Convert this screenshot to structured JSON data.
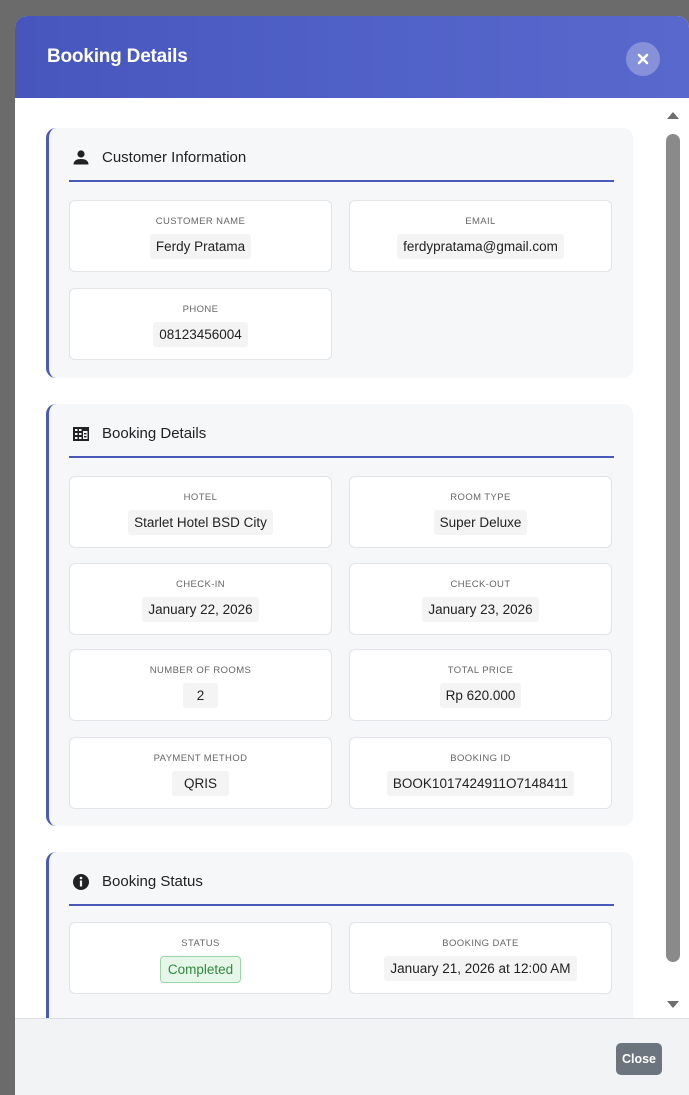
{
  "modal": {
    "title": "Booking Details",
    "close_button_label": "Close"
  },
  "customer_info": {
    "title": "Customer Information",
    "icon": "user-icon",
    "fields": [
      {
        "label": "CUSTOMER NAME",
        "value": "Ferdy Pratama"
      },
      {
        "label": "EMAIL",
        "value": "ferdypratama@gmail.com"
      },
      {
        "label": "PHONE",
        "value": "08123456004"
      }
    ]
  },
  "booking_details": {
    "title": "Booking Details",
    "icon": "building-icon",
    "fields": [
      {
        "label": "HOTEL",
        "value": "Starlet Hotel BSD City"
      },
      {
        "label": "ROOM TYPE",
        "value": "Super Deluxe"
      },
      {
        "label": "CHECK-IN",
        "value": "January 22, 2026"
      },
      {
        "label": "CHECK-OUT",
        "value": "January 23, 2026"
      },
      {
        "label": "NUMBER OF ROOMS",
        "value": "2"
      },
      {
        "label": "TOTAL PRICE",
        "value": "Rp 620.000"
      },
      {
        "label": "PAYMENT METHOD",
        "value": "QRIS"
      },
      {
        "label": "BOOKING ID",
        "value": "BOOK1017424911O7148411"
      }
    ]
  },
  "booking_status": {
    "title": "Booking Status",
    "icon": "info-icon",
    "fields": [
      {
        "label": "STATUS",
        "value": "Completed"
      },
      {
        "label": "BOOKING DATE",
        "value": "January 21, 2026 at 12:00 AM"
      }
    ]
  },
  "colors": {
    "header_gradient_start": "#4656bd",
    "header_gradient_end": "#5968cc",
    "accent": "#4a58b9",
    "status_success_bg": "#e6f6e8",
    "status_success_text": "#2e8b3d",
    "close_button_bg": "#6c757d"
  }
}
